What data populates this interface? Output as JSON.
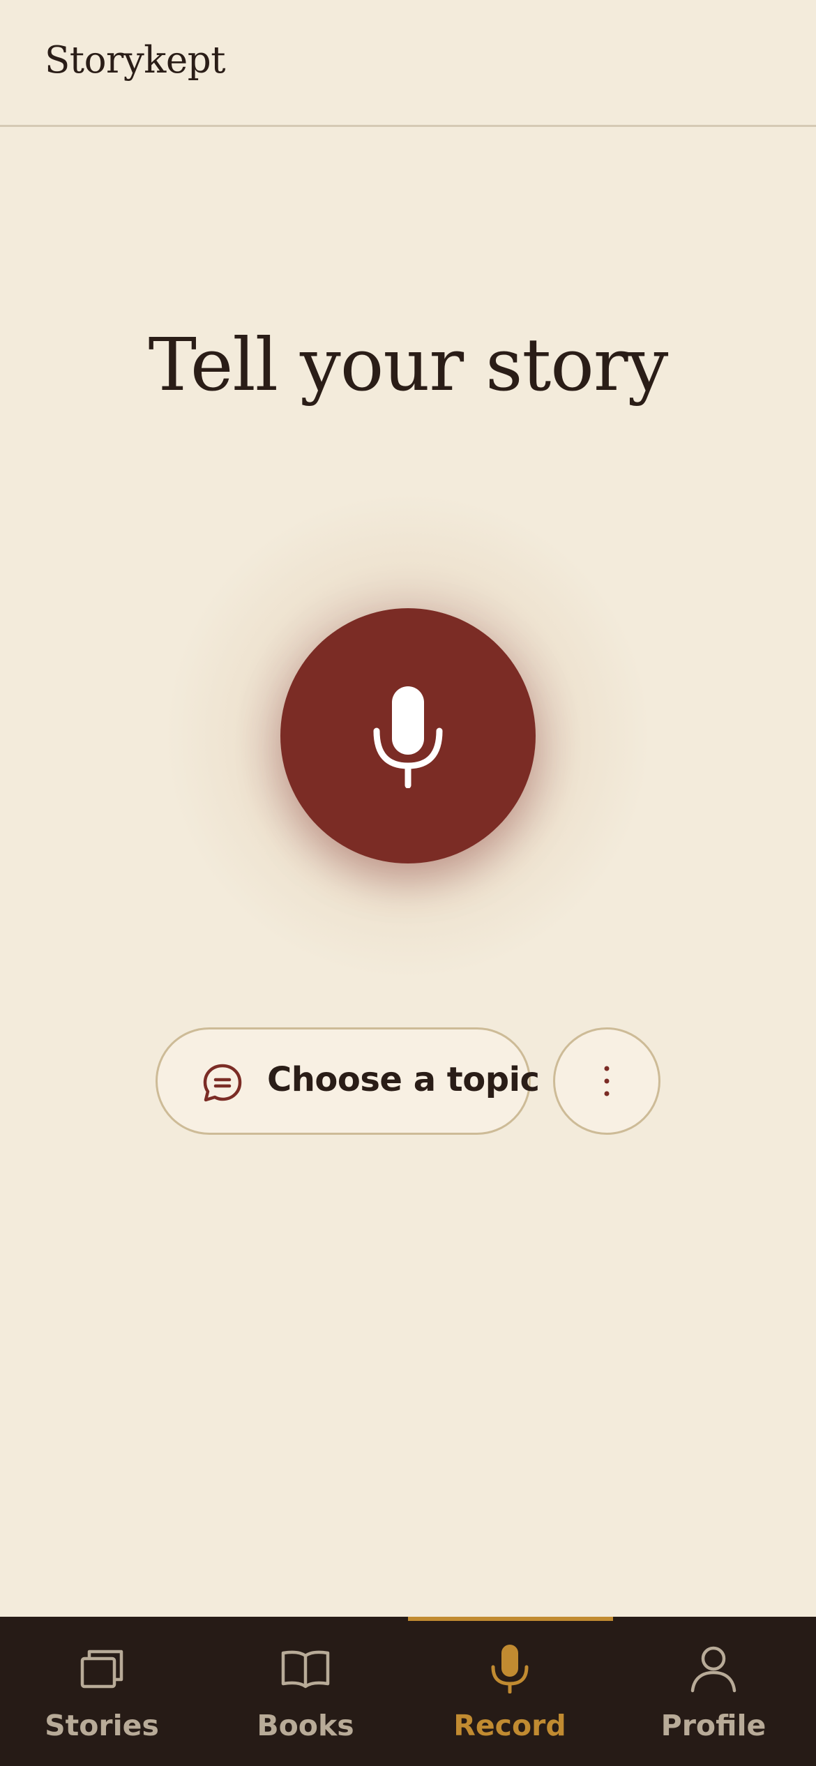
{
  "app": {
    "title": "Storykept"
  },
  "main": {
    "headline": "Tell your story",
    "record_icon": "microphone-icon",
    "topic_button_label": "Choose a topic",
    "topic_icon": "chat-bubble-icon",
    "more_icon": "more-vertical-icon"
  },
  "tabbar": {
    "active_index": 2,
    "items": [
      {
        "label": "Stories",
        "icon": "stack-cards-icon"
      },
      {
        "label": "Books",
        "icon": "open-book-icon"
      },
      {
        "label": "Record",
        "icon": "microphone-icon"
      },
      {
        "label": "Profile",
        "icon": "person-icon"
      }
    ]
  },
  "colors": {
    "background": "#f3ebdb",
    "accent_red": "#7b2c25",
    "accent_gold": "#c18b31",
    "tabbar_bg": "#261b16",
    "text_dark": "#2a1d17",
    "tab_inactive": "#b8ab98"
  }
}
